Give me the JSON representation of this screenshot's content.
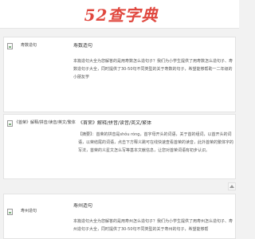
{
  "header": {
    "logo_text": "52查字典"
  },
  "articles": [
    {
      "image_alt": "寿数造句",
      "title": "寿数造句",
      "description": "本篇造句大全为您解答的是用寿数怎么造句子？我们为小学生提供了用寿数怎么造句子、寿数造句子大全，同时提供了30-50句不同类型的关于寿数的句子，希望能够帮助一二年级的小朋友学"
    },
    {
      "image_alt": "《首荣》解释/拼音/读音/英文/繁体",
      "title": "《首荣》解释/拼音/读音/英文/繁体",
      "description": "【摘要】：首荣的拼音是shǒu róng，首字母开头的词语，关于首的组词，以首开头的词语，以荣结尾的词语，点击下方释义跳可在线快速查看首荣的读音，此外首荣的繁体字的写法，首荣的义星文怎么写等基本文献信息，让您对首荣词语有初步认识。"
    },
    {
      "image_alt": "寿州造句",
      "title": "寿州造句",
      "description": "本篇造句大全为您解答的是用寿州怎么造句子？我们为小学生提供了用寿州怎么造句子、寿州造句子大全，同时提供了30-50句不同类型的关于寿州的句子，希望能够帮"
    }
  ],
  "colors": {
    "logo": "#e0483f",
    "background": "#f2f2f2"
  },
  "icons": {
    "broken_image": "broken-image-icon",
    "scroll_top": "chevron-up-icon"
  }
}
